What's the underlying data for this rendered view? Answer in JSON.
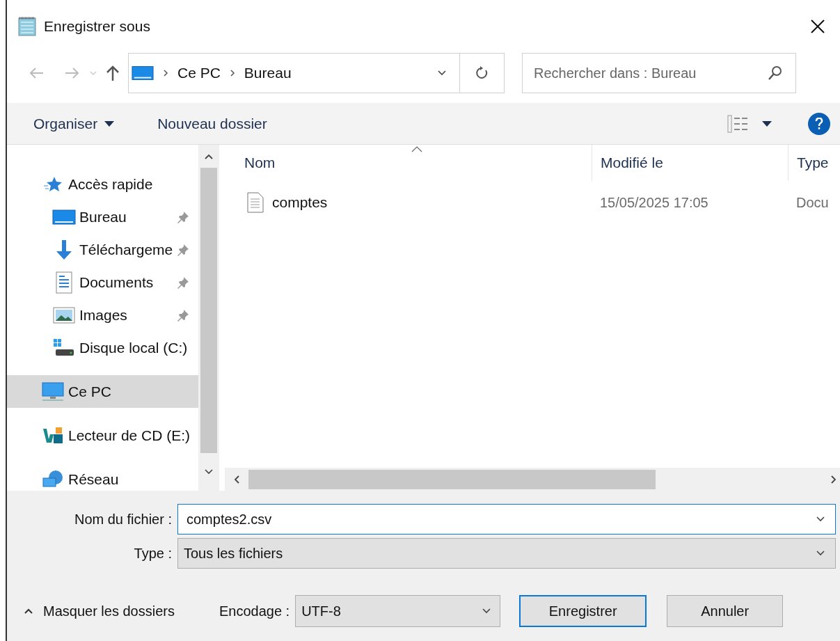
{
  "window": {
    "title": "Enregistrer sous"
  },
  "address_bar": {
    "crumbs": [
      "Ce PC",
      "Bureau"
    ]
  },
  "search": {
    "placeholder": "Rechercher dans : Bureau"
  },
  "toolbar": {
    "organize": "Organiser",
    "new_folder": "Nouveau dossier"
  },
  "sidebar": {
    "items": [
      {
        "label": "Accès rapide",
        "selected": false,
        "children": [
          {
            "label": "Bureau",
            "selected": false,
            "pinned": true
          },
          {
            "label": "Téléchargeme",
            "selected": false,
            "pinned": true
          },
          {
            "label": "Documents",
            "selected": false,
            "pinned": true
          },
          {
            "label": "Images",
            "selected": false,
            "pinned": true
          },
          {
            "label": "Disque local (C:)",
            "selected": false,
            "pinned": false
          }
        ]
      },
      {
        "label": "Ce PC",
        "selected": true
      },
      {
        "label": "Lecteur de CD (E:)",
        "selected": false
      },
      {
        "label": "Réseau",
        "selected": false
      }
    ]
  },
  "table": {
    "columns": [
      "Nom",
      "Modifié le",
      "Type"
    ],
    "rows": [
      {
        "name": "comptes",
        "modified": "15/05/2025 17:05",
        "type": "Docu",
        "selected": false
      }
    ]
  },
  "form": {
    "filename_label": "Nom du fichier :",
    "filename": "comptes2.csv",
    "type_label": "Type :",
    "type": "Tous les fichiers",
    "encoding_label": "Encodage :",
    "encoding": "UTF-8"
  },
  "buttons": {
    "hide_folders": "Masquer les dossiers",
    "save": "Enregistrer",
    "cancel": "Annuler"
  }
}
